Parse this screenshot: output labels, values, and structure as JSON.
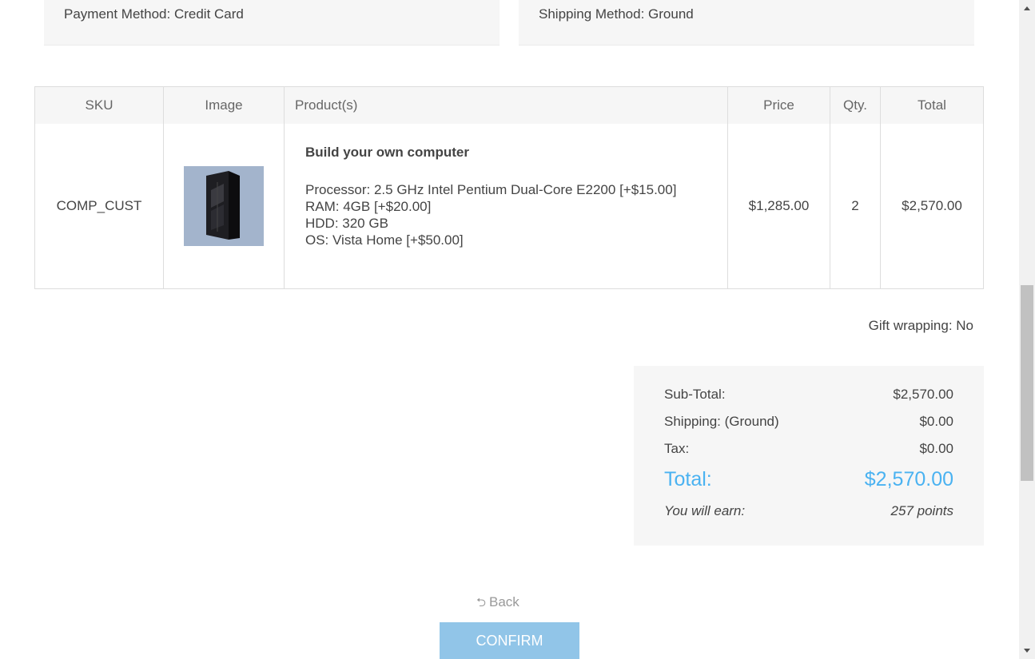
{
  "info": {
    "payment_method": "Payment Method: Credit Card",
    "shipping_method": "Shipping Method: Ground"
  },
  "table": {
    "headers": {
      "sku": "SKU",
      "image": "Image",
      "products": "Product(s)",
      "price": "Price",
      "qty": "Qty.",
      "total": "Total"
    },
    "rows": [
      {
        "sku": "COMP_CUST",
        "product_name": "Build your own computer",
        "attributes": [
          "Processor: 2.5 GHz Intel Pentium Dual-Core E2200 [+$15.00]",
          "RAM: 4GB [+$20.00]",
          "HDD: 320 GB",
          "OS: Vista Home [+$50.00]"
        ],
        "price": "$1,285.00",
        "qty": "2",
        "total": "$2,570.00"
      }
    ]
  },
  "gift_wrapping": "Gift wrapping: No",
  "totals": {
    "subtotal_label": "Sub-Total:",
    "subtotal_value": "$2,570.00",
    "shipping_label": "Shipping: (Ground)",
    "shipping_value": "$0.00",
    "tax_label": "Tax:",
    "tax_value": "$0.00",
    "total_label": "Total:",
    "total_value": "$2,570.00",
    "earn_label": "You will earn:",
    "earn_value": "257 points"
  },
  "actions": {
    "back_label": "Back",
    "confirm_label": "Confirm"
  },
  "colors": {
    "accent": "#4ab2f1",
    "confirm_bg": "#91c5e8",
    "panel_bg": "#f6f6f6"
  },
  "icons": {
    "back": "back-arrow-icon",
    "product_image": "computer-tower-image"
  }
}
